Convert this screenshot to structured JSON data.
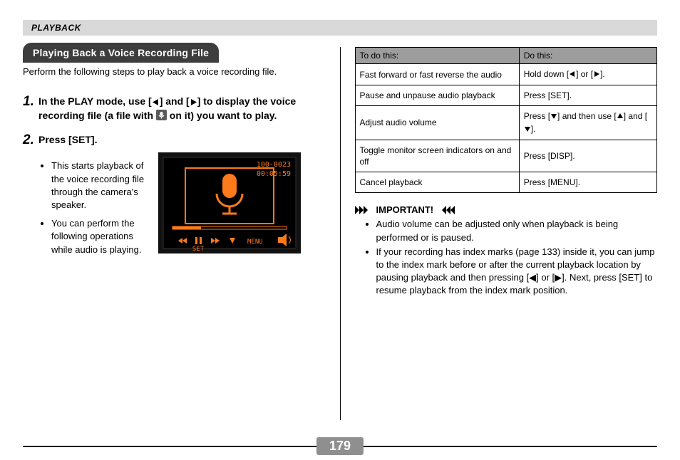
{
  "header": {
    "section": "PLAYBACK"
  },
  "section_title": "Playing Back a Voice Recording File",
  "intro": "Perform the following steps to play back a voice recording file.",
  "steps": [
    {
      "num": "1.",
      "head_pre": "In the PLAY mode, use [",
      "head_mid": "] and [",
      "head_post": "] to display the voice recording file (a file with ",
      "head_tail": " on it) you want to play."
    },
    {
      "num": "2.",
      "head": "Press [SET].",
      "bullets": [
        "This starts playback of the voice recording file through the camera's speaker.",
        "You can perform the following operations while audio is playing."
      ],
      "lcd": {
        "file_id": "100-0023",
        "time": "00:05:59",
        "labels": {
          "set": "SET",
          "menu": "MENU"
        }
      }
    }
  ],
  "table": {
    "headers": [
      "To do this:",
      "Do this:"
    ],
    "rows": [
      {
        "l": "Fast forward or fast reverse the audio",
        "r_pre": "Hold down [",
        "r_mid": "] or [",
        "r_post": "]."
      },
      {
        "l": "Pause and unpause audio playback",
        "r": "Press [SET]."
      },
      {
        "l": "Adjust audio volume",
        "r_pre": "Press [",
        "r_mid": "] and then use [",
        "r_mid2": "] and [",
        "r_post": "]."
      },
      {
        "l": "Toggle monitor screen indicators on and off",
        "r": "Press [DISP]."
      },
      {
        "l": "Cancel playback",
        "r": "Press [MENU]."
      }
    ]
  },
  "important": {
    "label": "IMPORTANT!",
    "items": [
      "Audio volume can be adjusted only when playback is being performed or is paused.",
      "If your recording has index marks (page 133) inside it, you can jump to the index mark before or after the current playback location by pausing playback and then pressing [◀] or [▶]. Next, press [SET] to resume playback from the index mark position."
    ]
  },
  "page_number": "179"
}
